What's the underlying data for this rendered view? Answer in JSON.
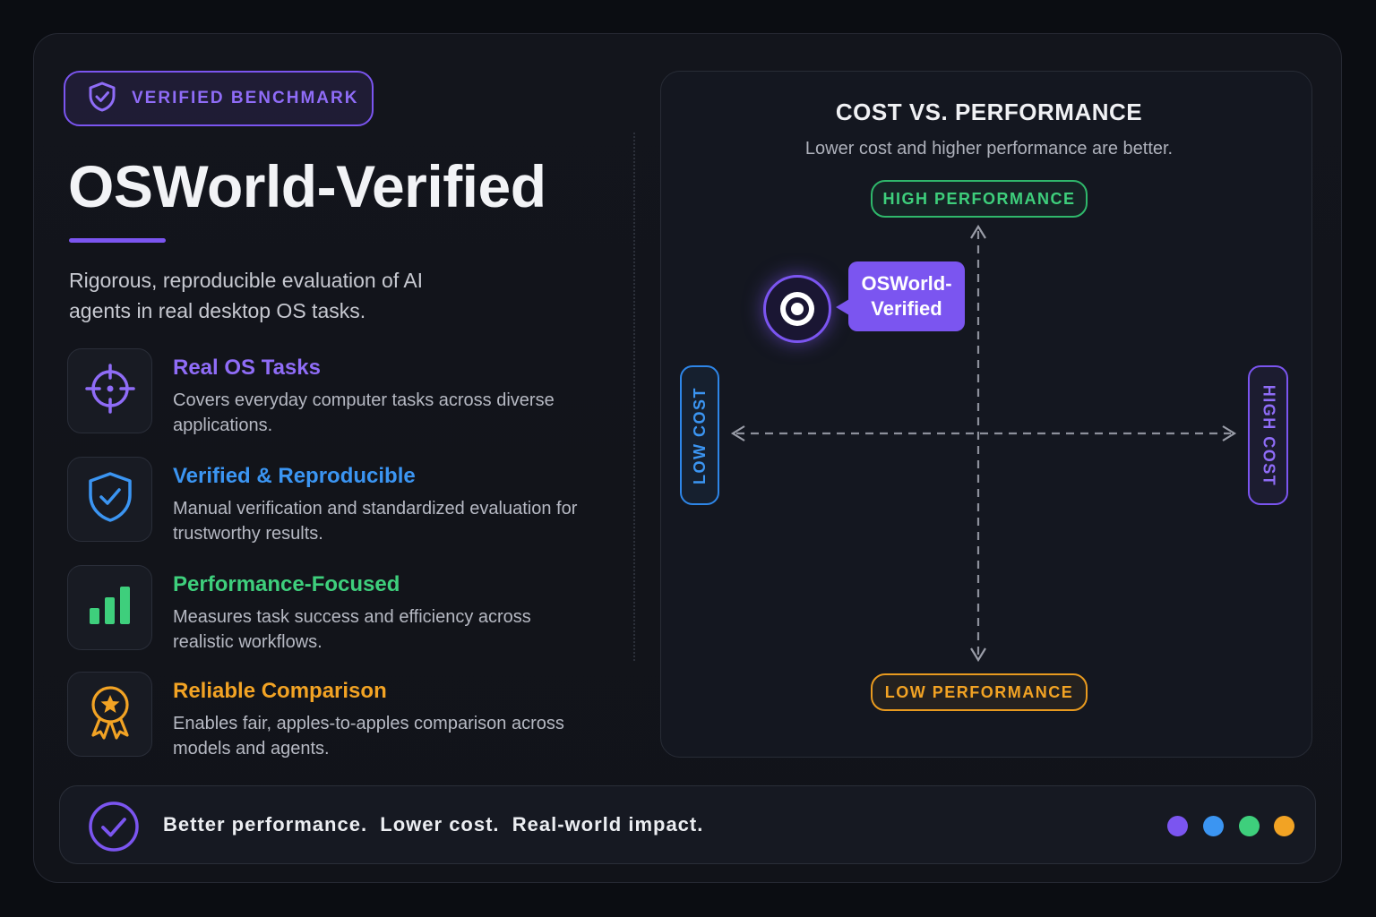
{
  "badge": {
    "label": "VERIFIED BENCHMARK",
    "icon": "shield-check-icon"
  },
  "header": {
    "title": "OSWorld-Verified",
    "subtitle": "Rigorous, reproducible evaluation of AI agents in real desktop OS tasks."
  },
  "features": [
    {
      "icon": "crosshair-icon",
      "title": "Real OS Tasks",
      "desc": "Covers everyday computer tasks across diverse applications.",
      "color": "#8f6cf7"
    },
    {
      "icon": "shield-check-icon",
      "title": "Verified & Reproducible",
      "desc": "Manual verification and standardized evaluation for trustworthy results.",
      "color": "#3b95f2"
    },
    {
      "icon": "bar-chart-icon",
      "title": "Performance-Focused",
      "desc": "Measures task success and efficiency across realistic workflows.",
      "color": "#3ecf7c"
    },
    {
      "icon": "award-ribbon-icon",
      "title": "Reliable Comparison",
      "desc": "Enables fair, apples-to-apples comparison across models and agents.",
      "color": "#f2a324"
    }
  ],
  "chart": {
    "title": "COST VS. PERFORMANCE",
    "subtitle": "Lower cost and higher performance are better.",
    "axis_top": "HIGH PERFORMANCE",
    "axis_bottom": "LOW PERFORMANCE",
    "axis_left": "LOW COST",
    "axis_right": "HIGH COST",
    "point_label": "OSWorld-Verified"
  },
  "footer": {
    "text": "Better performance.  Lower cost.  Real-world impact.",
    "dots": [
      "#7b55f0",
      "#3b95f2",
      "#3ecf7c",
      "#f2a324"
    ]
  }
}
